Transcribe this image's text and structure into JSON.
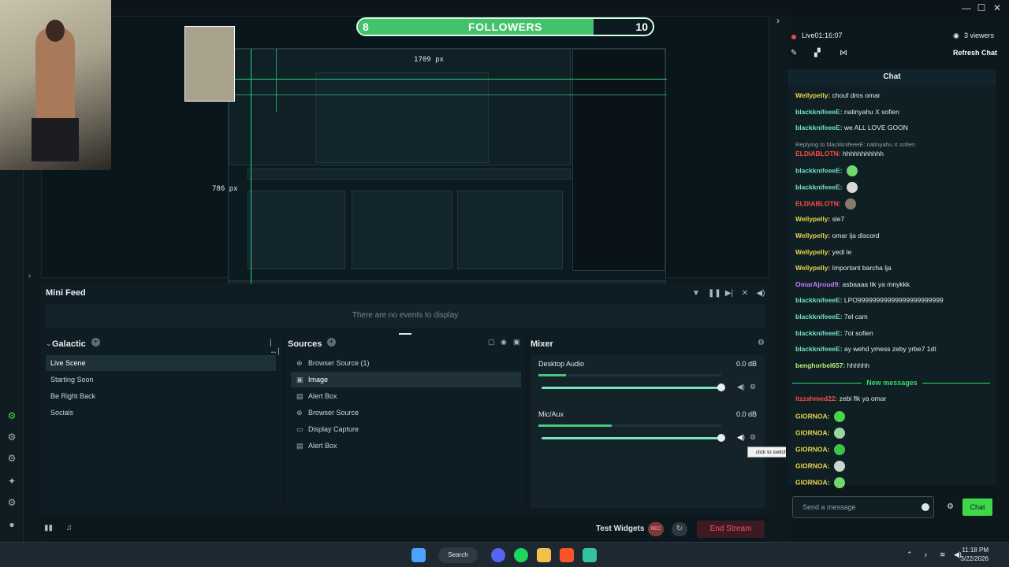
{
  "window": {
    "minimize": "—",
    "maximize": "☐",
    "close": "✕",
    "expand": "›"
  },
  "followers": {
    "current": "8",
    "title": "FOLLOWERS",
    "goal": "10",
    "progress_fraction": 0.8
  },
  "preview": {
    "dim_width": "1709 px",
    "dim_height": "786 px"
  },
  "mini_feed": {
    "title": "Mini Feed",
    "empty": "There are no events to display"
  },
  "scenes": {
    "title": "Galactic",
    "items": [
      "Live Scene",
      "Starting Soon",
      "Be Right Back",
      "Socials"
    ],
    "active_index": 0
  },
  "sources": {
    "title": "Sources",
    "items": [
      {
        "label": "Browser Source (1)",
        "icon": "globe-icon",
        "glyph": "⊕"
      },
      {
        "label": "Image",
        "icon": "image-icon",
        "glyph": "▣"
      },
      {
        "label": "Alert Box",
        "icon": "widget-icon",
        "glyph": "▤"
      },
      {
        "label": "Browser Source",
        "icon": "globe-icon",
        "glyph": "⊕"
      },
      {
        "label": "Display Capture",
        "icon": "monitor-icon",
        "glyph": "▭"
      },
      {
        "label": "Alert Box",
        "icon": "widget-icon",
        "glyph": "▤"
      }
    ]
  },
  "mixer": {
    "title": "Mixer",
    "channels": [
      {
        "name": "Desktop Audio",
        "db": "0.0 dB",
        "level": 0.15,
        "volume": 1.0
      },
      {
        "name": "Mic/Aux",
        "db": "0.0 dB",
        "level": 0.4,
        "volume": 1.0
      }
    ],
    "tooltip": "click to switch off"
  },
  "bottom": {
    "test_widgets": "Test Widgets",
    "rec": "REC",
    "end_stream": "End Stream"
  },
  "chat": {
    "status": "Live01:16:07",
    "viewers": "3 viewers",
    "refresh": "Refresh Chat",
    "header": "Chat",
    "messages": [
      {
        "user": "Wellypelly:",
        "text": "chouf dms omar",
        "color": "#e8d44d"
      },
      {
        "user": "blackknifeeeE:",
        "text": "natinyahu X sofien",
        "color": "#6fe0c8"
      },
      {
        "user": "blackknifeeeE:",
        "text": "we ALL LOVE GOON",
        "color": "#6fe0c8"
      },
      {
        "reply": "Replying to blackknifeeeE: natinyahu X sofien"
      },
      {
        "user": "ELDIABLOTN:",
        "text": "hhhhhhhhhhh",
        "color": "#ff4a4a"
      },
      {
        "user": "blackknifeeeE:",
        "text": "",
        "color": "#6fe0c8",
        "emote": "#6fd86f"
      },
      {
        "user": "blackknifeeeE:",
        "text": "",
        "color": "#6fe0c8",
        "emote": "#d8d8d8"
      },
      {
        "user": "ELDIABLOTN:",
        "text": "",
        "color": "#ff4a4a",
        "emote": "#8a7a6a"
      },
      {
        "user": "Wellypelly:",
        "text": "sle7",
        "color": "#e8d44d"
      },
      {
        "user": "Wellypelly:",
        "text": "omar ija discord",
        "color": "#e8d44d"
      },
      {
        "user": "Wellypelly:",
        "text": "yedi le",
        "color": "#e8d44d"
      },
      {
        "user": "Wellypelly:",
        "text": "Important barcha lja",
        "color": "#e8d44d"
      },
      {
        "user": "OmarAjroud9:",
        "text": "asbaaaa lik ya mnykkk",
        "color": "#c77dff"
      },
      {
        "user": "blackknifeeeE:",
        "text": "LPO99999999999999999999999",
        "color": "#6fe0c8"
      },
      {
        "user": "blackknifeeeE:",
        "text": "7el cam",
        "color": "#6fe0c8"
      },
      {
        "user": "blackknifeeeE:",
        "text": "7ot sofien",
        "color": "#6fe0c8"
      },
      {
        "user": "blackknifeeeE:",
        "text": "ay wehd ymess zeby yrbe7 1dt",
        "color": "#6fe0c8"
      },
      {
        "user": "benghorbel657:",
        "text": "hhhhhh",
        "color": "#b6f07a"
      }
    ],
    "new_messages": "New messages",
    "new": [
      {
        "user": "itzzahmed22:",
        "text": "zebi flk ya omar",
        "color": "#ff4a4a"
      },
      {
        "user": "GIORNOA:",
        "text": "",
        "color": "#e8d44d",
        "emote": "#49d449"
      },
      {
        "user": "GIORNOA:",
        "text": "",
        "color": "#e8d44d",
        "emote": "#9ad6a0"
      },
      {
        "user": "GIORNOA:",
        "text": "",
        "color": "#e8d44d",
        "emote": "#3fc24a"
      },
      {
        "user": "GIORNOA:",
        "text": "",
        "color": "#e8d44d",
        "emote": "#c8d8c8"
      },
      {
        "user": "GIORNOA:",
        "text": "",
        "color": "#e8d44d",
        "emote": "#6fd86f"
      }
    ],
    "input_placeholder": "Send a message",
    "send": "Chat"
  },
  "taskbar": {
    "search": "Search",
    "time": "11:18 PM",
    "date": "3/22/2026"
  }
}
